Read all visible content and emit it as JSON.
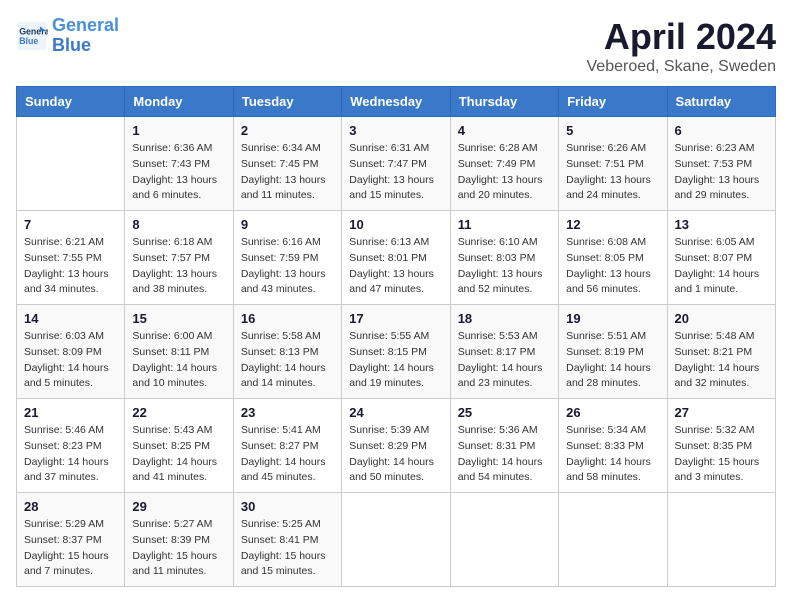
{
  "header": {
    "logo_line1": "General",
    "logo_line2": "Blue",
    "month_title": "April 2024",
    "location": "Veberoed, Skane, Sweden"
  },
  "calendar": {
    "days_of_week": [
      "Sunday",
      "Monday",
      "Tuesday",
      "Wednesday",
      "Thursday",
      "Friday",
      "Saturday"
    ],
    "weeks": [
      [
        {
          "day": "",
          "info": ""
        },
        {
          "day": "1",
          "info": "Sunrise: 6:36 AM\nSunset: 7:43 PM\nDaylight: 13 hours\nand 6 minutes."
        },
        {
          "day": "2",
          "info": "Sunrise: 6:34 AM\nSunset: 7:45 PM\nDaylight: 13 hours\nand 11 minutes."
        },
        {
          "day": "3",
          "info": "Sunrise: 6:31 AM\nSunset: 7:47 PM\nDaylight: 13 hours\nand 15 minutes."
        },
        {
          "day": "4",
          "info": "Sunrise: 6:28 AM\nSunset: 7:49 PM\nDaylight: 13 hours\nand 20 minutes."
        },
        {
          "day": "5",
          "info": "Sunrise: 6:26 AM\nSunset: 7:51 PM\nDaylight: 13 hours\nand 24 minutes."
        },
        {
          "day": "6",
          "info": "Sunrise: 6:23 AM\nSunset: 7:53 PM\nDaylight: 13 hours\nand 29 minutes."
        }
      ],
      [
        {
          "day": "7",
          "info": "Sunrise: 6:21 AM\nSunset: 7:55 PM\nDaylight: 13 hours\nand 34 minutes."
        },
        {
          "day": "8",
          "info": "Sunrise: 6:18 AM\nSunset: 7:57 PM\nDaylight: 13 hours\nand 38 minutes."
        },
        {
          "day": "9",
          "info": "Sunrise: 6:16 AM\nSunset: 7:59 PM\nDaylight: 13 hours\nand 43 minutes."
        },
        {
          "day": "10",
          "info": "Sunrise: 6:13 AM\nSunset: 8:01 PM\nDaylight: 13 hours\nand 47 minutes."
        },
        {
          "day": "11",
          "info": "Sunrise: 6:10 AM\nSunset: 8:03 PM\nDaylight: 13 hours\nand 52 minutes."
        },
        {
          "day": "12",
          "info": "Sunrise: 6:08 AM\nSunset: 8:05 PM\nDaylight: 13 hours\nand 56 minutes."
        },
        {
          "day": "13",
          "info": "Sunrise: 6:05 AM\nSunset: 8:07 PM\nDaylight: 14 hours\nand 1 minute."
        }
      ],
      [
        {
          "day": "14",
          "info": "Sunrise: 6:03 AM\nSunset: 8:09 PM\nDaylight: 14 hours\nand 5 minutes."
        },
        {
          "day": "15",
          "info": "Sunrise: 6:00 AM\nSunset: 8:11 PM\nDaylight: 14 hours\nand 10 minutes."
        },
        {
          "day": "16",
          "info": "Sunrise: 5:58 AM\nSunset: 8:13 PM\nDaylight: 14 hours\nand 14 minutes."
        },
        {
          "day": "17",
          "info": "Sunrise: 5:55 AM\nSunset: 8:15 PM\nDaylight: 14 hours\nand 19 minutes."
        },
        {
          "day": "18",
          "info": "Sunrise: 5:53 AM\nSunset: 8:17 PM\nDaylight: 14 hours\nand 23 minutes."
        },
        {
          "day": "19",
          "info": "Sunrise: 5:51 AM\nSunset: 8:19 PM\nDaylight: 14 hours\nand 28 minutes."
        },
        {
          "day": "20",
          "info": "Sunrise: 5:48 AM\nSunset: 8:21 PM\nDaylight: 14 hours\nand 32 minutes."
        }
      ],
      [
        {
          "day": "21",
          "info": "Sunrise: 5:46 AM\nSunset: 8:23 PM\nDaylight: 14 hours\nand 37 minutes."
        },
        {
          "day": "22",
          "info": "Sunrise: 5:43 AM\nSunset: 8:25 PM\nDaylight: 14 hours\nand 41 minutes."
        },
        {
          "day": "23",
          "info": "Sunrise: 5:41 AM\nSunset: 8:27 PM\nDaylight: 14 hours\nand 45 minutes."
        },
        {
          "day": "24",
          "info": "Sunrise: 5:39 AM\nSunset: 8:29 PM\nDaylight: 14 hours\nand 50 minutes."
        },
        {
          "day": "25",
          "info": "Sunrise: 5:36 AM\nSunset: 8:31 PM\nDaylight: 14 hours\nand 54 minutes."
        },
        {
          "day": "26",
          "info": "Sunrise: 5:34 AM\nSunset: 8:33 PM\nDaylight: 14 hours\nand 58 minutes."
        },
        {
          "day": "27",
          "info": "Sunrise: 5:32 AM\nSunset: 8:35 PM\nDaylight: 15 hours\nand 3 minutes."
        }
      ],
      [
        {
          "day": "28",
          "info": "Sunrise: 5:29 AM\nSunset: 8:37 PM\nDaylight: 15 hours\nand 7 minutes."
        },
        {
          "day": "29",
          "info": "Sunrise: 5:27 AM\nSunset: 8:39 PM\nDaylight: 15 hours\nand 11 minutes."
        },
        {
          "day": "30",
          "info": "Sunrise: 5:25 AM\nSunset: 8:41 PM\nDaylight: 15 hours\nand 15 minutes."
        },
        {
          "day": "",
          "info": ""
        },
        {
          "day": "",
          "info": ""
        },
        {
          "day": "",
          "info": ""
        },
        {
          "day": "",
          "info": ""
        }
      ]
    ]
  }
}
